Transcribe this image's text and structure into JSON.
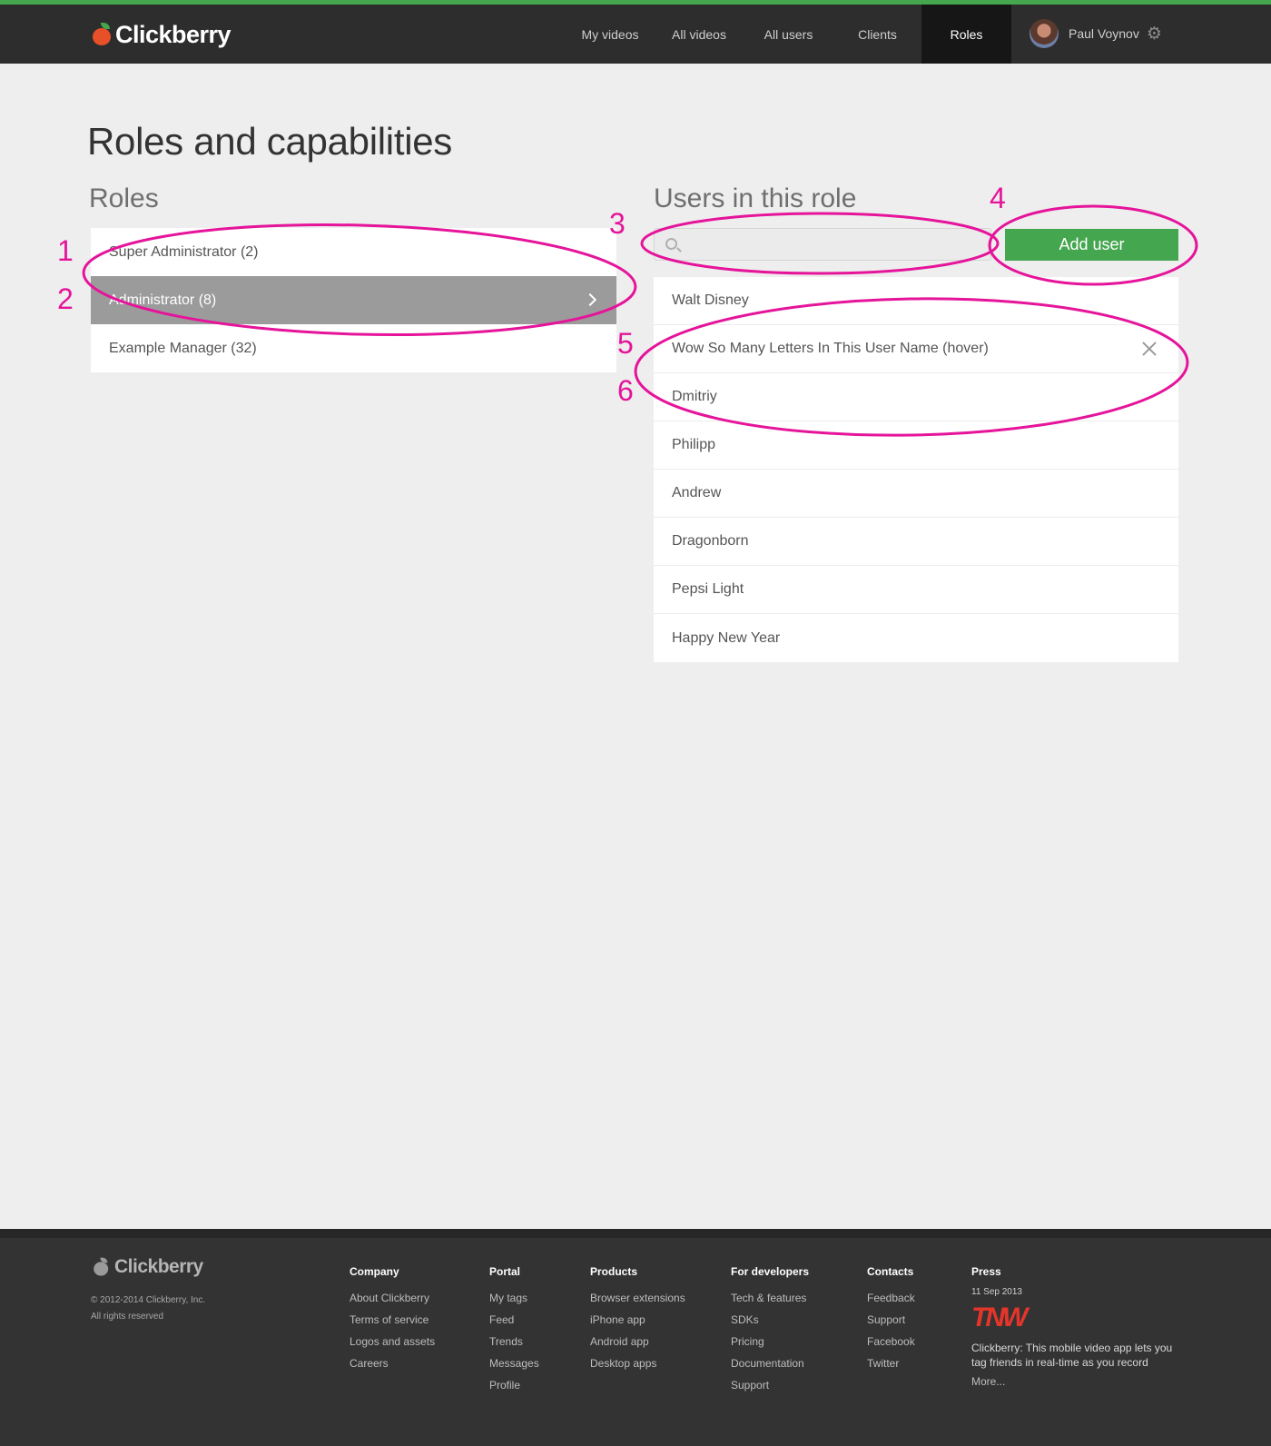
{
  "brand": {
    "name": "Clickberry",
    "accent": "#44a64e",
    "logo_berry": "#e8502a"
  },
  "nav": {
    "items": [
      {
        "label": "My videos"
      },
      {
        "label": "All videos"
      },
      {
        "label": "All users"
      },
      {
        "label": "Clients"
      },
      {
        "label": "Roles",
        "active": true
      }
    ],
    "user_name": "Paul Voynov"
  },
  "page": {
    "title": "Roles and capabilities",
    "roles_heading": "Roles",
    "users_heading": "Users in this role"
  },
  "roles": [
    {
      "label": "Super Administrator (2)"
    },
    {
      "label": "Administrator (8)",
      "active": true
    },
    {
      "label": "Example Manager (32)"
    }
  ],
  "search": {
    "value": "",
    "placeholder": ""
  },
  "add_user_label": "Add user",
  "users": [
    {
      "name": "Walt Disney"
    },
    {
      "name": "Wow So Many Letters In This User Name (hover)",
      "hover": true
    },
    {
      "name": "Dmitriy"
    },
    {
      "name": "Philipp"
    },
    {
      "name": "Andrew"
    },
    {
      "name": "Dragonborn"
    },
    {
      "name": "Pepsi Light"
    },
    {
      "name": "Happy New Year"
    }
  ],
  "annotations": [
    "1",
    "2",
    "3",
    "4",
    "5",
    "6"
  ],
  "footer": {
    "brand": "Clickberry",
    "copyright": "© 2012-2014 Clickberry, Inc.",
    "rights": "All rights reserved",
    "columns": [
      {
        "heading": "Company",
        "links": [
          "About Clickberry",
          "Terms of service",
          "Logos and assets",
          "Careers"
        ]
      },
      {
        "heading": "Portal",
        "links": [
          "My tags",
          "Feed",
          "Trends",
          "Messages",
          "Profile"
        ]
      },
      {
        "heading": "Products",
        "links": [
          "Browser extensions",
          "iPhone app",
          "Android app",
          "Desktop apps"
        ]
      },
      {
        "heading": "For developers",
        "links": [
          "Tech & features",
          "SDKs",
          "Pricing",
          "Documentation",
          "Support"
        ]
      },
      {
        "heading": "Contacts",
        "links": [
          "Feedback",
          "Support",
          "Facebook",
          "Twitter"
        ]
      }
    ],
    "press": {
      "heading": "Press",
      "date": "11 Sep 2013",
      "source": "TNW",
      "text": "Clickberry: This mobile video app lets you tag friends in real-time as you record",
      "more": "More..."
    }
  }
}
